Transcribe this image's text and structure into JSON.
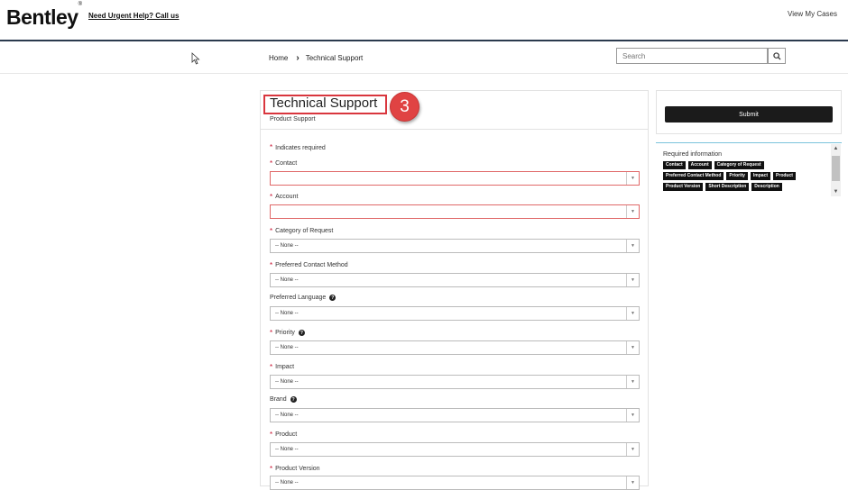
{
  "header": {
    "logo": "Bentley",
    "logo_mark": "®",
    "help_link": "Need Urgent Help? Call us",
    "view_cases": "View My Cases"
  },
  "breadcrumb": {
    "home": "Home",
    "separator": "›",
    "current": "Technical Support"
  },
  "search": {
    "placeholder": "Search"
  },
  "form": {
    "title": "Technical Support",
    "subtitle": "Product Support",
    "step_badge": "3",
    "required_star": "*",
    "required_note": "Indicates required",
    "fields": [
      {
        "label": "Contact",
        "required": true,
        "value": ""
      },
      {
        "label": "Account",
        "required": true,
        "value": ""
      },
      {
        "label": "Category of Request",
        "required": true,
        "value": "-- None --"
      },
      {
        "label": "Preferred Contact Method",
        "required": true,
        "value": "-- None --"
      },
      {
        "label": "Preferred Language",
        "required": false,
        "help": true,
        "value": "-- None --"
      },
      {
        "label": "Priority",
        "required": true,
        "help": true,
        "value": "-- None --"
      },
      {
        "label": "Impact",
        "required": true,
        "value": "-- None --"
      },
      {
        "label": "Brand",
        "required": false,
        "help": true,
        "value": "-- None --"
      },
      {
        "label": "Product",
        "required": true,
        "value": "-- None --"
      },
      {
        "label": "Product Version",
        "required": true,
        "value": "-- None --"
      }
    ]
  },
  "sidebar": {
    "submit_label": "Submit",
    "required_info_title": "Required information",
    "required_tags": [
      "Contact",
      "Account",
      "Category of Request",
      "Preferred Contact Method",
      "Priority",
      "Impact",
      "Product",
      "Product Version",
      "Short Description",
      "Description"
    ]
  },
  "colors": {
    "accent_red": "#d9363e",
    "header_border": "#2b3a4e",
    "submit_bg": "#1b1b1b",
    "required_star": "#c8102e"
  }
}
